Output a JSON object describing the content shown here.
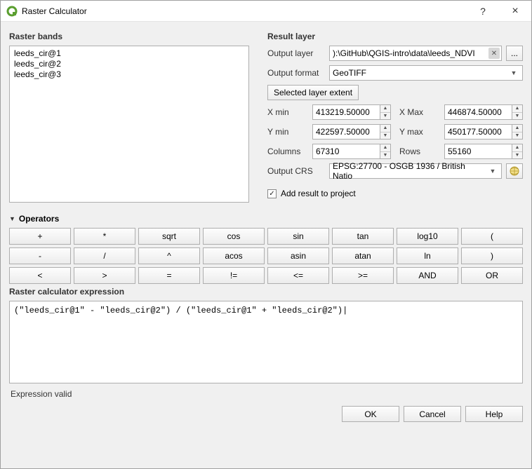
{
  "window": {
    "title": "Raster Calculator"
  },
  "bands": {
    "title": "Raster bands",
    "items": [
      "leeds_cir@1",
      "leeds_cir@2",
      "leeds_cir@3"
    ]
  },
  "result": {
    "title": "Result layer",
    "output_layer_label": "Output layer",
    "output_layer_value": "):\\GitHub\\QGIS-intro\\data\\leeds_NDVI",
    "browse_label": "...",
    "output_format_label": "Output format",
    "output_format_value": "GeoTIFF",
    "selected_extent_label": "Selected layer extent",
    "xmin_label": "X min",
    "xmin": "413219.50000",
    "xmax_label": "X Max",
    "xmax": "446874.50000",
    "ymin_label": "Y min",
    "ymin": "422597.50000",
    "ymax_label": "Y max",
    "ymax": "450177.50000",
    "cols_label": "Columns",
    "cols": "67310",
    "rows_label": "Rows",
    "rows": "55160",
    "crs_label": "Output CRS",
    "crs_value": "EPSG:27700 - OSGB 1936 / British Natio",
    "add_result_label": "Add result to project",
    "add_result_checked": true
  },
  "operators": {
    "title": "Operators",
    "row1": [
      "+",
      "*",
      "sqrt",
      "cos",
      "sin",
      "tan",
      "log10",
      "("
    ],
    "row2": [
      "-",
      "/",
      "^",
      "acos",
      "asin",
      "atan",
      "ln",
      ")"
    ],
    "row3": [
      "<",
      ">",
      "=",
      "!=",
      "<=",
      ">=",
      "AND",
      "OR"
    ]
  },
  "expression": {
    "title": "Raster calculator expression",
    "text": "(\"leeds_cir@1\" - \"leeds_cir@2\") / (\"leeds_cir@1\" + \"leeds_cir@2\")"
  },
  "status": "Expression valid",
  "buttons": {
    "ok": "OK",
    "cancel": "Cancel",
    "help": "Help"
  }
}
